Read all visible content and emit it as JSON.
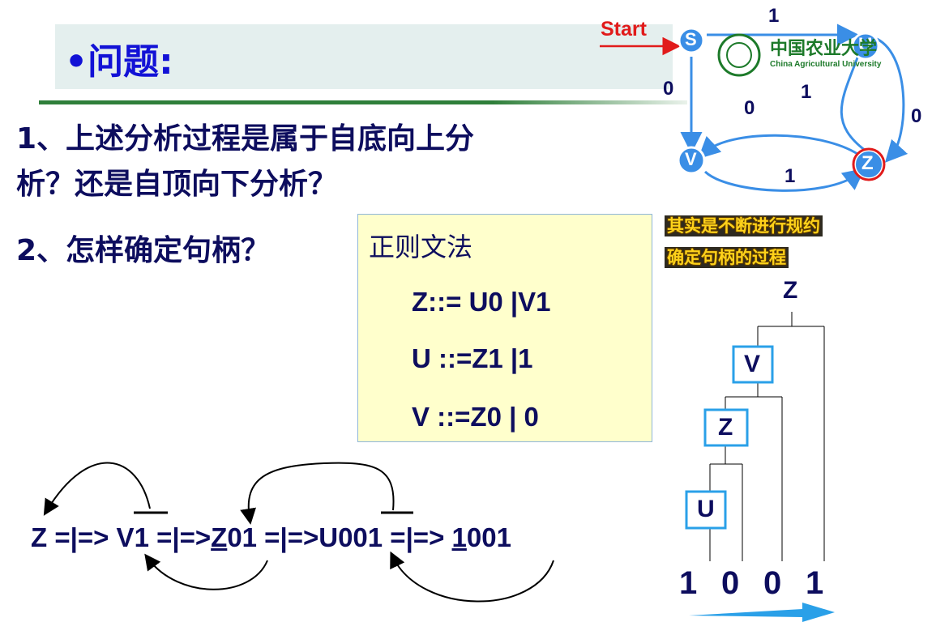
{
  "title": "•问题:",
  "questions": [
    {
      "line1": "1、上述分析过程是属于自底向上分",
      "line2": "析？还是自顶向下分析？"
    },
    {
      "line1": "2、怎样确定句柄？"
    }
  ],
  "grammar": {
    "title": "正则文法",
    "rules": [
      "Z::= U0 |V1",
      "U ::=Z1 |1",
      "V ::=Z0 | 0"
    ]
  },
  "derivation": {
    "parts": [
      "Z =|=> ",
      "V",
      "1 =|=>",
      "Z",
      "01 =|=>",
      "U",
      "001 =|=> ",
      "1",
      "001"
    ]
  },
  "automaton": {
    "start_label": "Start",
    "states": [
      "S",
      "U",
      "V",
      "Z"
    ],
    "edge_labels": [
      "1",
      "0",
      "1",
      "0",
      "0",
      "1"
    ],
    "final_state": "Z",
    "colors": {
      "edge": "#3a8ee6",
      "start_arrow": "#e11b1b",
      "final_ring": "#e11b1b",
      "state_fill": "#3a8ee6"
    }
  },
  "logo": {
    "name_cn": "中国农业大学",
    "name_en": "China Agricultural University"
  },
  "note": {
    "line1": "其实是不断进行规约",
    "line2": "确定句柄的过程"
  },
  "tree": {
    "root": "Z",
    "nodes": [
      "V",
      "Z",
      "U"
    ],
    "leaves": [
      "1",
      "0",
      "0",
      "1"
    ]
  }
}
